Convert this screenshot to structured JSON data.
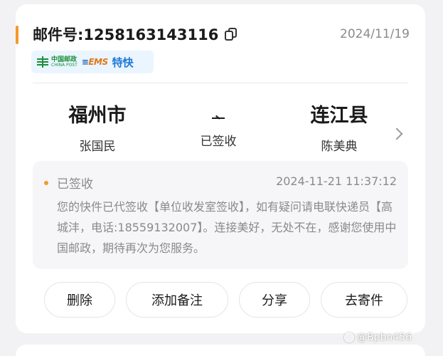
{
  "header": {
    "waybill_label": "邮件号:1258163143116",
    "date": "2024/11/19"
  },
  "carrier": {
    "post_cn": "中国邮政",
    "post_en": "CHINA POST",
    "ems_label": "EMS",
    "service": "特快"
  },
  "route": {
    "from_city": "福州市",
    "from_person": "张国民",
    "status": "已签收",
    "to_city": "连江县",
    "to_person": "陈美典"
  },
  "tracking": {
    "title": "已签收",
    "time": "2024-11-21 11:37:12",
    "description": "您的快件已代签收【单位收发室签收】，如有疑问请电联快递员【高城沣，电话:18559132007】。连接美好，无处不在，感谢您使用中国邮政，期待再次为您服务。"
  },
  "actions": {
    "delete": "删除",
    "add_note": "添加备注",
    "share": "分享",
    "send": "去寄件"
  },
  "watermark": "@Bpbn456",
  "colors": {
    "accent": "#f39a2b",
    "service_blue": "#1e78d6",
    "china_post_green": "#1a8f3a"
  }
}
